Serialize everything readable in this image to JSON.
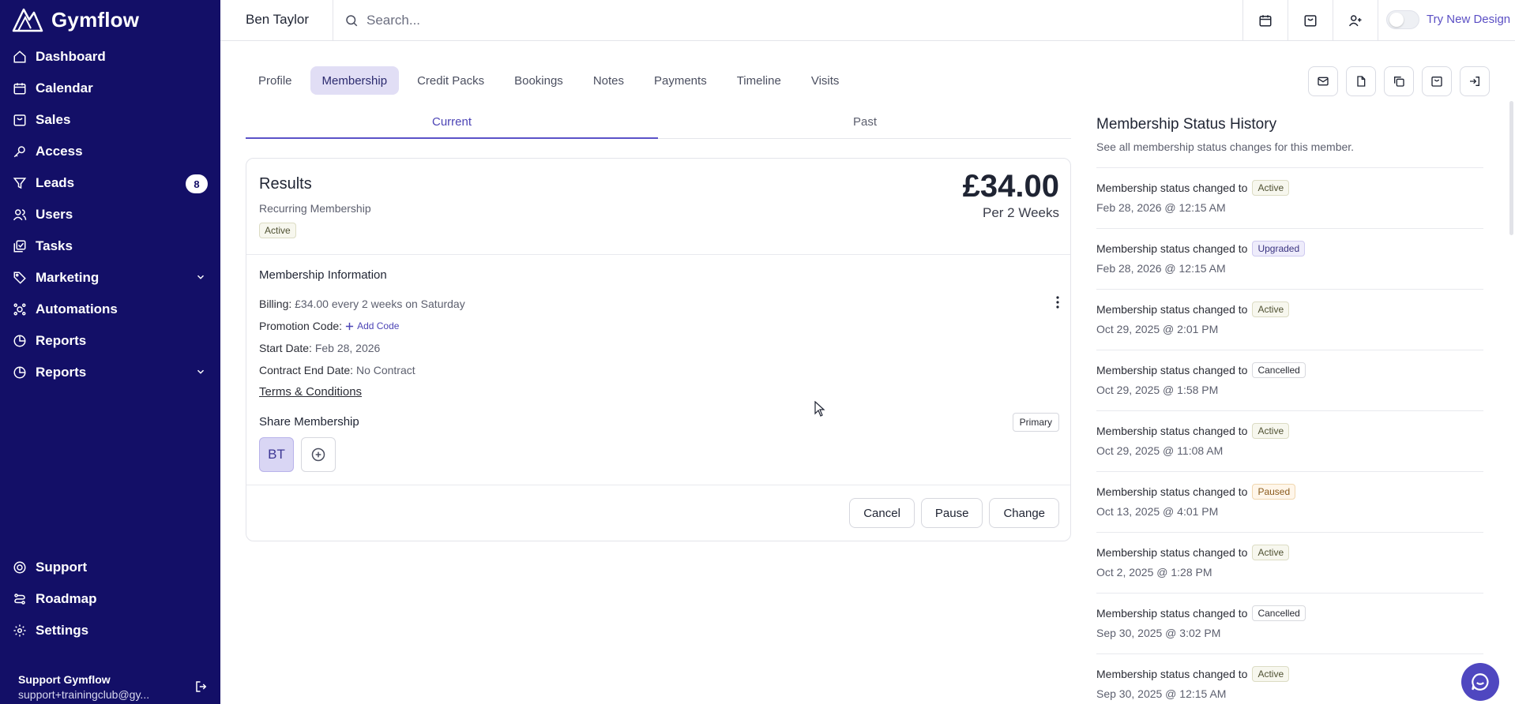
{
  "brand": {
    "name": "Gymflow"
  },
  "nav": {
    "items": [
      {
        "label": "Dashboard",
        "icon": "home-icon"
      },
      {
        "label": "Calendar",
        "icon": "calendar-icon"
      },
      {
        "label": "Sales",
        "icon": "shopping-bag-icon"
      },
      {
        "label": "Access",
        "icon": "key-icon"
      },
      {
        "label": "Leads",
        "icon": "funnel-icon",
        "badge": "8"
      },
      {
        "label": "Users",
        "icon": "users-icon"
      },
      {
        "label": "Tasks",
        "icon": "tasks-icon"
      },
      {
        "label": "Marketing",
        "icon": "tag-icon"
      },
      {
        "label": "Automations",
        "icon": "automation-icon"
      },
      {
        "label": "Reports",
        "icon": "pie-chart-icon"
      },
      {
        "label": "Reports",
        "icon": "pie-chart-icon"
      }
    ],
    "bottom": [
      {
        "label": "Support",
        "icon": "lifebuoy-icon"
      },
      {
        "label": "Roadmap",
        "icon": "roadmap-icon"
      },
      {
        "label": "Settings",
        "icon": "gear-icon"
      }
    ],
    "user": {
      "name": "Support Gymflow",
      "email": "support+trainingclub@gy..."
    }
  },
  "topbar": {
    "member_name": "Ben Taylor",
    "search_placeholder": "Search...",
    "try_new_design": "Try New Design"
  },
  "tabs": [
    "Profile",
    "Membership",
    "Credit Packs",
    "Bookings",
    "Notes",
    "Payments",
    "Timeline",
    "Visits"
  ],
  "subtabs": {
    "current": "Current",
    "past": "Past"
  },
  "membership": {
    "title": "Results",
    "type": "Recurring Membership",
    "status": "Active",
    "price": "£34.00",
    "period": "Per 2 Weeks",
    "info_title": "Membership Information",
    "billing_key": "Billing:",
    "billing_val": "£34.00 every 2 weeks on Saturday",
    "promo_key": "Promotion Code:",
    "add_code": "Add Code",
    "start_key": "Start Date:",
    "start_val": "Feb 28, 2026",
    "contract_key": "Contract End Date:",
    "contract_val": "No Contract",
    "terms": "Terms & Conditions",
    "share_title": "Share Membership",
    "primary": "Primary",
    "avatar_initials": "BT",
    "buttons": {
      "cancel": "Cancel",
      "pause": "Pause",
      "change": "Change"
    }
  },
  "history": {
    "title": "Membership Status History",
    "subtitle": "See all membership status changes for this member.",
    "prefix": "Membership status changed to",
    "items": [
      {
        "status": "Active",
        "date": "Feb 28, 2026 @ 12:15 AM"
      },
      {
        "status": "Upgraded",
        "date": "Feb 28, 2026 @ 12:15 AM"
      },
      {
        "status": "Active",
        "date": "Oct 29, 2025 @ 2:01 PM"
      },
      {
        "status": "Cancelled",
        "date": "Oct 29, 2025 @ 1:58 PM"
      },
      {
        "status": "Active",
        "date": "Oct 29, 2025 @ 11:08 AM"
      },
      {
        "status": "Paused",
        "date": "Oct 13, 2025 @ 4:01 PM"
      },
      {
        "status": "Active",
        "date": "Oct 2, 2025 @ 1:28 PM"
      },
      {
        "status": "Cancelled",
        "date": "Sep 30, 2025 @ 3:02 PM"
      },
      {
        "status": "Active",
        "date": "Sep 30, 2025 @ 12:15 AM"
      }
    ]
  },
  "colors": {
    "sidebar": "#130f67",
    "accent": "#5b52c8",
    "active_tab": "#e1def5"
  }
}
